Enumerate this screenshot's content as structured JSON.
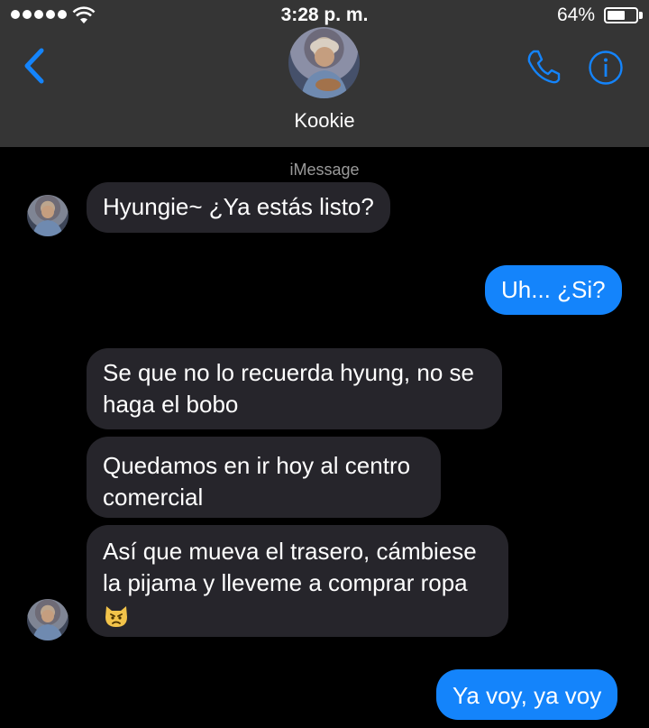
{
  "status_bar": {
    "time": "3:28 p. m.",
    "battery": "64%",
    "battery_level": 0.64
  },
  "header": {
    "contact_name": "Kookie",
    "back_icon": "chevron-left-icon",
    "call_icon": "phone-icon",
    "info_icon": "info-icon",
    "accent": "#1484fb",
    "background": "#353535"
  },
  "conversation": {
    "service_label": "iMessage",
    "messages": [
      {
        "direction": "incoming",
        "text": "Hyungie~ ¿Ya estás listo?"
      },
      {
        "direction": "outgoing",
        "text": "Uh... ¿Si?"
      },
      {
        "direction": "incoming",
        "text": "Se que no lo recuerda hyung, no se haga el bobo"
      },
      {
        "direction": "incoming",
        "text": "Quedamos en ir hoy al centro comercial"
      },
      {
        "direction": "incoming",
        "text": "Así que mueva el trasero, cámbiese la pijama y lleveme a comprar ropa",
        "emoji": "pouting-cat-face"
      },
      {
        "direction": "outgoing",
        "text": "Ya voy, ya voy"
      }
    ],
    "incoming_color": "#26252b",
    "outgoing_color": "#1484fb"
  }
}
